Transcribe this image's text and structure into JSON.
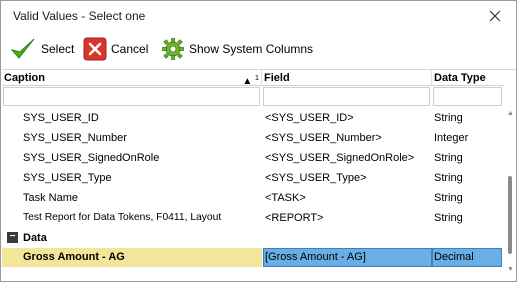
{
  "window": {
    "title": "Valid Values - Select one"
  },
  "icons": {
    "close": "close-icon",
    "select": "checkmark-icon",
    "cancel": "cancel-x-icon",
    "system": "gear-icon"
  },
  "toolbar": {
    "select_label": "Select",
    "cancel_label": "Cancel",
    "system_columns_label": "Show System Columns"
  },
  "grid": {
    "columns": [
      {
        "label": "Caption",
        "sort_indicator": "▲",
        "sort_order": "1"
      },
      {
        "label": "Field"
      },
      {
        "label": "Data Type"
      }
    ],
    "rows": [
      {
        "caption": "SYS_USER_ID",
        "field": "<SYS_USER_ID>",
        "type": "String"
      },
      {
        "caption": "SYS_USER_Number",
        "field": "<SYS_USER_Number>",
        "type": "Integer"
      },
      {
        "caption": "SYS_USER_SignedOnRole",
        "field": "<SYS_USER_SignedOnRole>",
        "type": "String"
      },
      {
        "caption": "SYS_USER_Type",
        "field": "<SYS_USER_Type>",
        "type": "String"
      },
      {
        "caption": "Task Name",
        "field": "<TASK>",
        "type": "String"
      },
      {
        "caption": "Test Report for Data Tokens, F0411, Layout",
        "field": "<REPORT>",
        "type": "String"
      }
    ],
    "group": {
      "toggle": "−",
      "label": "Data"
    },
    "selected_row": {
      "caption": "Gross Amount - AG",
      "field": "[Gross Amount - AG]",
      "type": "Decimal"
    }
  },
  "colors": {
    "selected_caption_bg": "#f2e69a",
    "selected_cell_bg": "#6aaee6",
    "check_green": "#4caf1f",
    "cancel_red": "#d9342b"
  }
}
